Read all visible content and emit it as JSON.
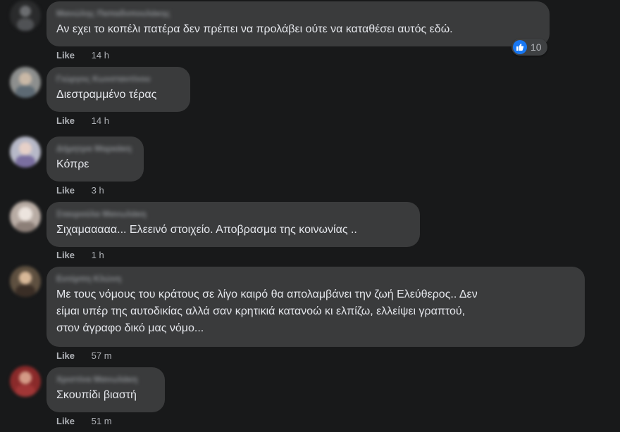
{
  "colors": {
    "background": "#18191a",
    "bubble": "#3a3b3c",
    "text": "#e4e6eb",
    "meta": "#b0b3b8",
    "like_blue": "#1877f2"
  },
  "comments": [
    {
      "author": "Μανώλης Παπαδοπουλάκης",
      "text": "Αν εχει το κοπέλι πατέρα δεν πρέπει να προλάβει ούτε να καταθέσει αυτός εδώ.",
      "like_label": "Like",
      "time": "14 h",
      "reactions": {
        "icon": "thumbs-up-icon",
        "count": "10"
      }
    },
    {
      "author": "Γιώργος Κωνσταντίνου",
      "text": "Διεστραμμένο τέρας",
      "like_label": "Like",
      "time": "14 h"
    },
    {
      "author": "Δήμητρα Μαρκάκη",
      "text": "Κόπρε",
      "like_label": "Like",
      "time": "3 h"
    },
    {
      "author": "Σταυρούλα Μανωλάκη",
      "text": "Σιχαμααααα... Ελεεινό στοιχείο. Αποβρασμα της κοινωνίας ..",
      "like_label": "Like",
      "time": "1 h"
    },
    {
      "author": "Ευτέρπη Κλώνη",
      "text": "Με τους νόμους του κράτους σε λίγο καιρό θα απολαμβάνει την ζωή Ελεύθερος.. Δεν\nείμαι υπέρ της αυτοδικίας αλλά σαν κρητικιά κατανοώ κι ελπίζω, ελλείψει γραπτού,\nστον άγραφο δικό μας νόμο...",
      "like_label": "Like",
      "time": "57 m"
    },
    {
      "author": "Χριστίνα Μανωλάκη",
      "text": "Σκουπίδι βιαστή",
      "like_label": "Like",
      "time": "51 m"
    }
  ]
}
